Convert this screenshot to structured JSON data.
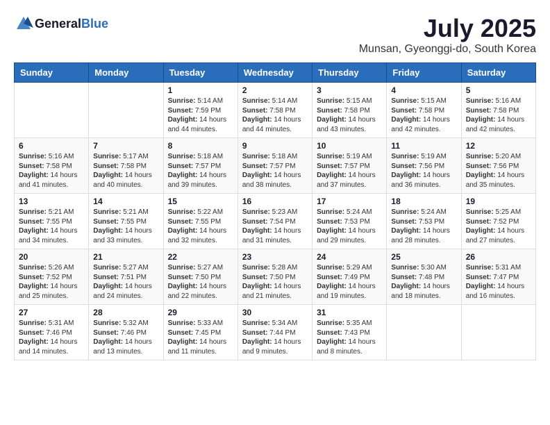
{
  "header": {
    "logo_general": "General",
    "logo_blue": "Blue",
    "title": "July 2025",
    "subtitle": "Munsan, Gyeonggi-do, South Korea"
  },
  "calendar": {
    "days_of_week": [
      "Sunday",
      "Monday",
      "Tuesday",
      "Wednesday",
      "Thursday",
      "Friday",
      "Saturday"
    ],
    "weeks": [
      [
        {
          "day": "",
          "info": ""
        },
        {
          "day": "",
          "info": ""
        },
        {
          "day": "1",
          "info": "Sunrise: 5:14 AM\nSunset: 7:59 PM\nDaylight: 14 hours and 44 minutes."
        },
        {
          "day": "2",
          "info": "Sunrise: 5:14 AM\nSunset: 7:58 PM\nDaylight: 14 hours and 44 minutes."
        },
        {
          "day": "3",
          "info": "Sunrise: 5:15 AM\nSunset: 7:58 PM\nDaylight: 14 hours and 43 minutes."
        },
        {
          "day": "4",
          "info": "Sunrise: 5:15 AM\nSunset: 7:58 PM\nDaylight: 14 hours and 42 minutes."
        },
        {
          "day": "5",
          "info": "Sunrise: 5:16 AM\nSunset: 7:58 PM\nDaylight: 14 hours and 42 minutes."
        }
      ],
      [
        {
          "day": "6",
          "info": "Sunrise: 5:16 AM\nSunset: 7:58 PM\nDaylight: 14 hours and 41 minutes."
        },
        {
          "day": "7",
          "info": "Sunrise: 5:17 AM\nSunset: 7:58 PM\nDaylight: 14 hours and 40 minutes."
        },
        {
          "day": "8",
          "info": "Sunrise: 5:18 AM\nSunset: 7:57 PM\nDaylight: 14 hours and 39 minutes."
        },
        {
          "day": "9",
          "info": "Sunrise: 5:18 AM\nSunset: 7:57 PM\nDaylight: 14 hours and 38 minutes."
        },
        {
          "day": "10",
          "info": "Sunrise: 5:19 AM\nSunset: 7:57 PM\nDaylight: 14 hours and 37 minutes."
        },
        {
          "day": "11",
          "info": "Sunrise: 5:19 AM\nSunset: 7:56 PM\nDaylight: 14 hours and 36 minutes."
        },
        {
          "day": "12",
          "info": "Sunrise: 5:20 AM\nSunset: 7:56 PM\nDaylight: 14 hours and 35 minutes."
        }
      ],
      [
        {
          "day": "13",
          "info": "Sunrise: 5:21 AM\nSunset: 7:55 PM\nDaylight: 14 hours and 34 minutes."
        },
        {
          "day": "14",
          "info": "Sunrise: 5:21 AM\nSunset: 7:55 PM\nDaylight: 14 hours and 33 minutes."
        },
        {
          "day": "15",
          "info": "Sunrise: 5:22 AM\nSunset: 7:55 PM\nDaylight: 14 hours and 32 minutes."
        },
        {
          "day": "16",
          "info": "Sunrise: 5:23 AM\nSunset: 7:54 PM\nDaylight: 14 hours and 31 minutes."
        },
        {
          "day": "17",
          "info": "Sunrise: 5:24 AM\nSunset: 7:53 PM\nDaylight: 14 hours and 29 minutes."
        },
        {
          "day": "18",
          "info": "Sunrise: 5:24 AM\nSunset: 7:53 PM\nDaylight: 14 hours and 28 minutes."
        },
        {
          "day": "19",
          "info": "Sunrise: 5:25 AM\nSunset: 7:52 PM\nDaylight: 14 hours and 27 minutes."
        }
      ],
      [
        {
          "day": "20",
          "info": "Sunrise: 5:26 AM\nSunset: 7:52 PM\nDaylight: 14 hours and 25 minutes."
        },
        {
          "day": "21",
          "info": "Sunrise: 5:27 AM\nSunset: 7:51 PM\nDaylight: 14 hours and 24 minutes."
        },
        {
          "day": "22",
          "info": "Sunrise: 5:27 AM\nSunset: 7:50 PM\nDaylight: 14 hours and 22 minutes."
        },
        {
          "day": "23",
          "info": "Sunrise: 5:28 AM\nSunset: 7:50 PM\nDaylight: 14 hours and 21 minutes."
        },
        {
          "day": "24",
          "info": "Sunrise: 5:29 AM\nSunset: 7:49 PM\nDaylight: 14 hours and 19 minutes."
        },
        {
          "day": "25",
          "info": "Sunrise: 5:30 AM\nSunset: 7:48 PM\nDaylight: 14 hours and 18 minutes."
        },
        {
          "day": "26",
          "info": "Sunrise: 5:31 AM\nSunset: 7:47 PM\nDaylight: 14 hours and 16 minutes."
        }
      ],
      [
        {
          "day": "27",
          "info": "Sunrise: 5:31 AM\nSunset: 7:46 PM\nDaylight: 14 hours and 14 minutes."
        },
        {
          "day": "28",
          "info": "Sunrise: 5:32 AM\nSunset: 7:46 PM\nDaylight: 14 hours and 13 minutes."
        },
        {
          "day": "29",
          "info": "Sunrise: 5:33 AM\nSunset: 7:45 PM\nDaylight: 14 hours and 11 minutes."
        },
        {
          "day": "30",
          "info": "Sunrise: 5:34 AM\nSunset: 7:44 PM\nDaylight: 14 hours and 9 minutes."
        },
        {
          "day": "31",
          "info": "Sunrise: 5:35 AM\nSunset: 7:43 PM\nDaylight: 14 hours and 8 minutes."
        },
        {
          "day": "",
          "info": ""
        },
        {
          "day": "",
          "info": ""
        }
      ]
    ]
  }
}
